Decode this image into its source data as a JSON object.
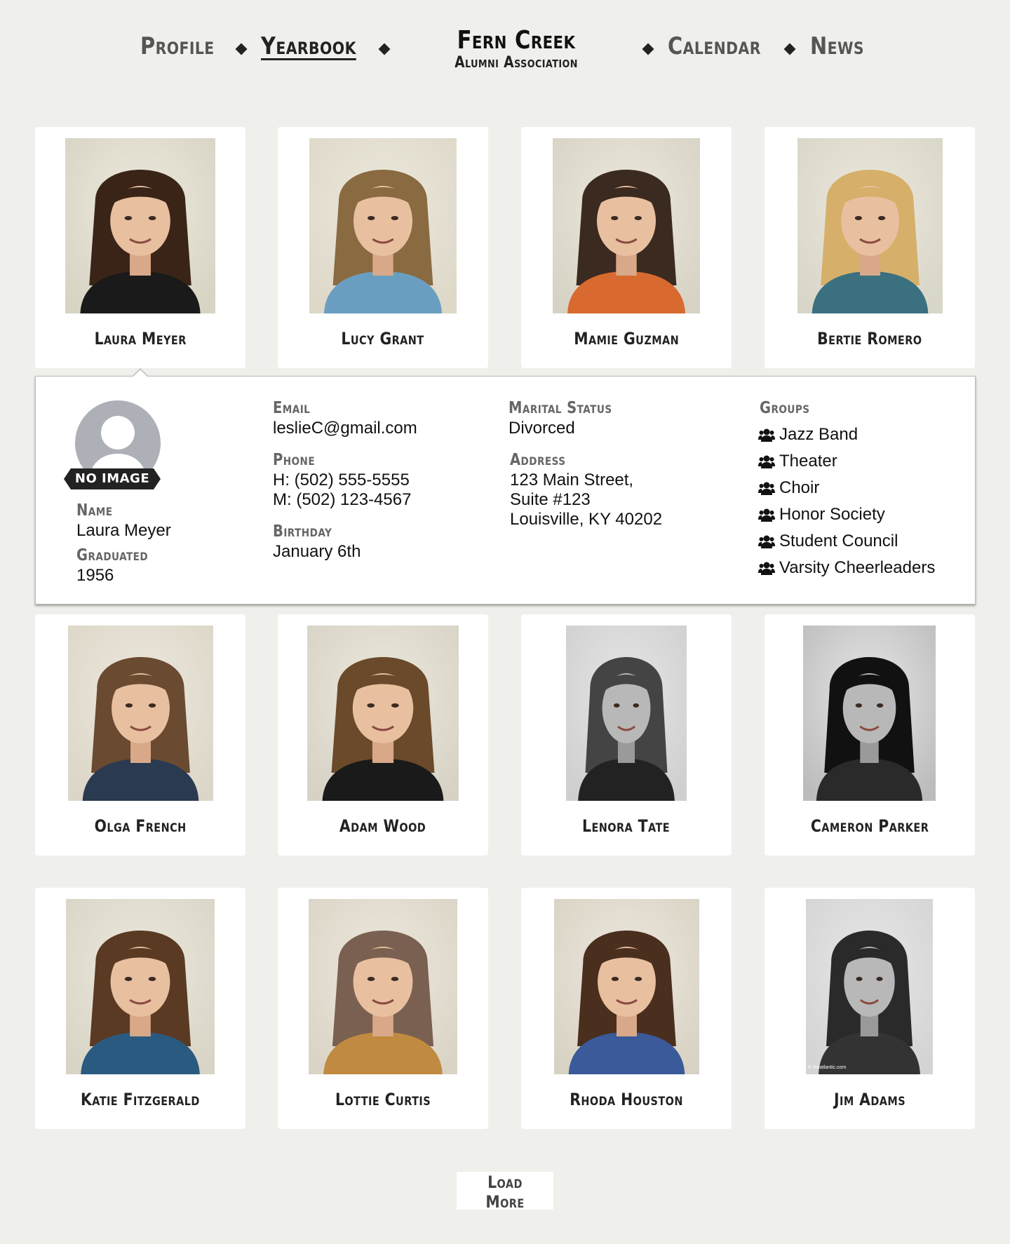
{
  "nav": {
    "profile": "Profile",
    "yearbook": "Yearbook",
    "calendar": "Calendar",
    "news": "News",
    "brand_title": "Fern Creek",
    "brand_subtitle": "Alumni Association"
  },
  "students": [
    {
      "name": "Laura Meyer",
      "photo": "color-portrait",
      "hair": "#3a2418",
      "shirt": "#1a1a1a",
      "bg": "#d8d4c4"
    },
    {
      "name": "Lucy Grant",
      "photo": "color-portrait",
      "hair": "#8a6a40",
      "shirt": "#6a9ec0",
      "bg": "#ddd8c8"
    },
    {
      "name": "Mamie Guzman",
      "photo": "color-portrait",
      "hair": "#3a2a20",
      "shirt": "#d86a30",
      "bg": "#d6d2c4"
    },
    {
      "name": "Bertie Romero",
      "photo": "color-portrait",
      "hair": "#d6b06a",
      "shirt": "#3a7080",
      "bg": "#d8d6c8"
    },
    {
      "name": "Olga French",
      "photo": "color-portrait",
      "hair": "#6a4a30",
      "shirt": "#2a3a50",
      "bg": "#dcd6c8"
    },
    {
      "name": "Adam Wood",
      "photo": "color-portrait",
      "hair": "#6a4a2a",
      "shirt": "#1a1a1a",
      "bg": "#d6d2c6"
    },
    {
      "name": "Lenora Tate",
      "photo": "bw-portrait",
      "hair": "#444444",
      "shirt": "#222222",
      "bg": "#cfcfcf"
    },
    {
      "name": "Cameron Parker",
      "photo": "bw-portrait",
      "hair": "#111111",
      "shirt": "#2a2a2a",
      "bg": "#bcbcbc"
    },
    {
      "name": "Katie Fitzgerald",
      "photo": "color-portrait",
      "hair": "#5a3a22",
      "shirt": "#2a5a80",
      "bg": "#d8d4c6"
    },
    {
      "name": "Lottie Curtis",
      "photo": "color-portrait",
      "hair": "#7a6050",
      "shirt": "#c08a40",
      "bg": "#dad4c6"
    },
    {
      "name": "Rhoda Houston",
      "photo": "color-portrait",
      "hair": "#4a2e1e",
      "shirt": "#3a5a9a",
      "bg": "#d8d2c4"
    },
    {
      "name": "Jim Adams",
      "photo": "bw-portrait",
      "hair": "#2a2a2a",
      "shirt": "#333333",
      "bg": "#d4d4d4"
    }
  ],
  "detail": {
    "no_image": "NO IMAGE",
    "name_label": "Name",
    "name": "Laura Meyer",
    "graduated_label": "Graduated",
    "graduated": "1956",
    "email_label": "Email",
    "email": "leslieC@gmail.com",
    "phone_label": "Phone",
    "phone_home": "H: (502) 555-5555",
    "phone_mobile": "M: (502) 123-4567",
    "birthday_label": "Birthday",
    "birthday": "January 6th",
    "marital_label": "Marital Status",
    "marital": "Divorced",
    "address_label": "Address",
    "address_line1": "123 Main Street,",
    "address_line2": "Suite #123",
    "address_line3": "Louisville, KY 40202",
    "groups_label": "Groups",
    "groups": [
      "Jazz Band",
      "Theater",
      "Choir",
      "Honor Society",
      "Student Council",
      "Varsity Cheerleaders"
    ],
    "group_icon": "users-icon"
  },
  "load_more": "Load More",
  "watermark": "© theatlantic.com",
  "colors": {
    "background": "#efefeb",
    "card": "#ffffff",
    "text": "#222222"
  }
}
